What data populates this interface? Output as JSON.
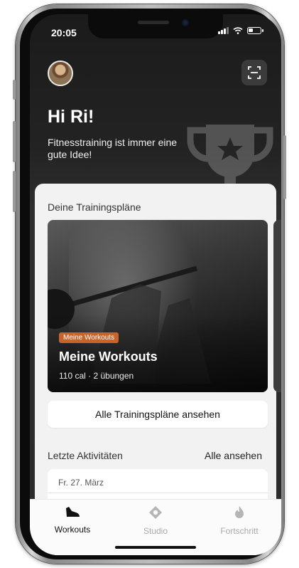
{
  "status_bar": {
    "time": "20:05",
    "icons": [
      "signal-icon",
      "wifi-icon",
      "battery-icon"
    ]
  },
  "header": {
    "avatar_icon": "user-avatar",
    "scan_icon": "scan-icon",
    "greeting": "Hi Ri!",
    "subtitle": "Fitnesstraining ist immer eine gute Idee!",
    "decor_icon": "trophy-icon"
  },
  "plans": {
    "section_title": "Deine Trainingspläne",
    "cards": [
      {
        "tag": "Meine Workouts",
        "title": "Meine Workouts",
        "meta": "110 cal · 2 übungen",
        "tag_color": "#c8642a"
      }
    ],
    "all_plans_button": "Alle Trainingspläne ansehen"
  },
  "recent": {
    "section_title": "Letzte Aktivitäten",
    "see_all": "Alle ansehen",
    "items": [
      {
        "date": "Fr. 27. März"
      }
    ]
  },
  "tabbar": {
    "tabs": [
      {
        "label": "Workouts",
        "icon": "shoe-icon",
        "active": true
      },
      {
        "label": "Studio",
        "icon": "location-icon",
        "active": false
      },
      {
        "label": "Fortschritt",
        "icon": "flame-icon",
        "active": false
      }
    ]
  },
  "colors": {
    "accent": "#c8642a",
    "header_bg": "#1b1b1b",
    "card_bg": "#f2f2f2"
  }
}
